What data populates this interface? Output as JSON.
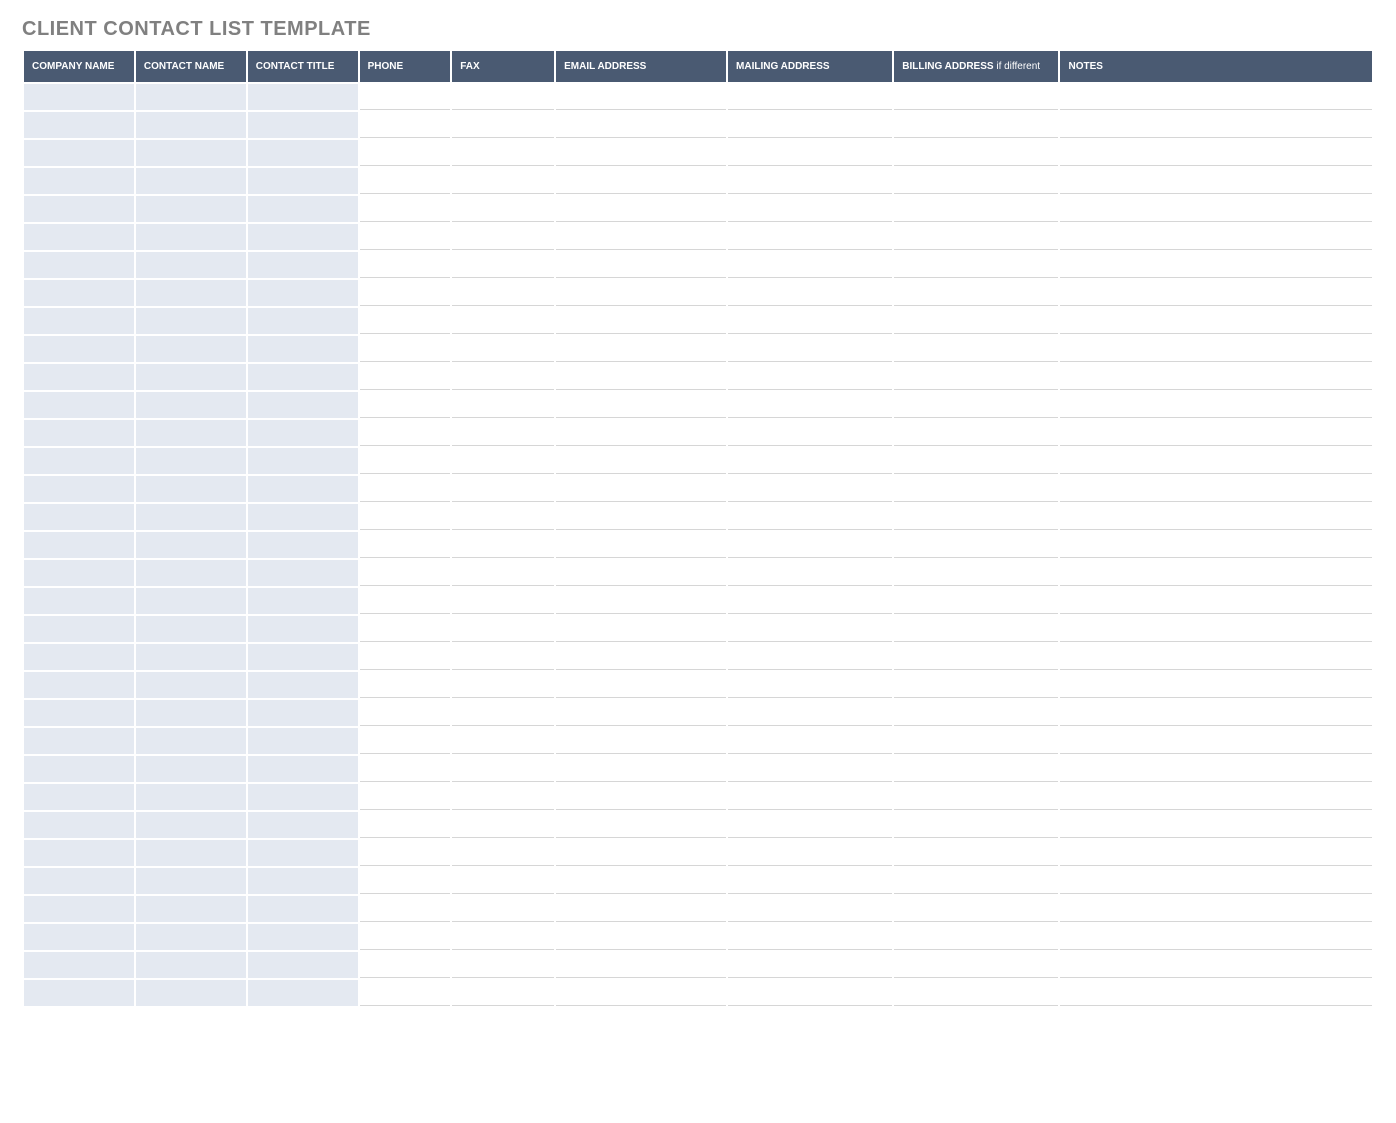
{
  "title": "CLIENT CONTACT LIST TEMPLATE",
  "columns": [
    {
      "label": "COMPANY NAME",
      "suffix": "",
      "shaded": true,
      "cls": "col-company"
    },
    {
      "label": "CONTACT NAME",
      "suffix": "",
      "shaded": true,
      "cls": "col-contact"
    },
    {
      "label": "CONTACT TITLE",
      "suffix": "",
      "shaded": true,
      "cls": "col-title"
    },
    {
      "label": "PHONE",
      "suffix": "",
      "shaded": false,
      "cls": "col-phone"
    },
    {
      "label": "FAX",
      "suffix": "",
      "shaded": false,
      "cls": "col-fax"
    },
    {
      "label": "EMAIL ADDRESS",
      "suffix": "",
      "shaded": false,
      "cls": "col-email"
    },
    {
      "label": "MAILING ADDRESS",
      "suffix": "",
      "shaded": false,
      "cls": "col-mail"
    },
    {
      "label": "BILLING ADDRESS",
      "suffix": " if different",
      "shaded": false,
      "cls": "col-bill"
    },
    {
      "label": "NOTES",
      "suffix": "",
      "shaded": false,
      "cls": "col-notes"
    }
  ],
  "rowCount": 33
}
